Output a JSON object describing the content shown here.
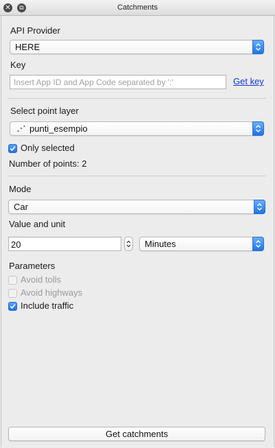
{
  "window": {
    "title": "Catchments"
  },
  "api_provider": {
    "label": "API Provider",
    "value": "HERE"
  },
  "key": {
    "label": "Key",
    "placeholder": "Insert App ID and App Code separated by ':'",
    "link": "Get key"
  },
  "point_layer": {
    "label": "Select point layer",
    "value": "punti_esempio",
    "only_selected": "Only selected",
    "only_selected_checked": true,
    "count_text": "Number of points: 2"
  },
  "mode": {
    "label": "Mode",
    "value": "Car"
  },
  "value_unit": {
    "label": "Value and unit",
    "value": "20",
    "unit": "Minutes"
  },
  "parameters": {
    "label": "Parameters",
    "items": [
      {
        "label": "Avoid tolls",
        "checked": false,
        "enabled": false
      },
      {
        "label": "Avoid highways",
        "checked": false,
        "enabled": false
      },
      {
        "label": "Include traffic",
        "checked": true,
        "enabled": true
      }
    ]
  },
  "action": {
    "label": "Get catchments"
  },
  "colors": {
    "accent": "#1f73e6",
    "link": "#1036d6",
    "background": "#ececec"
  }
}
